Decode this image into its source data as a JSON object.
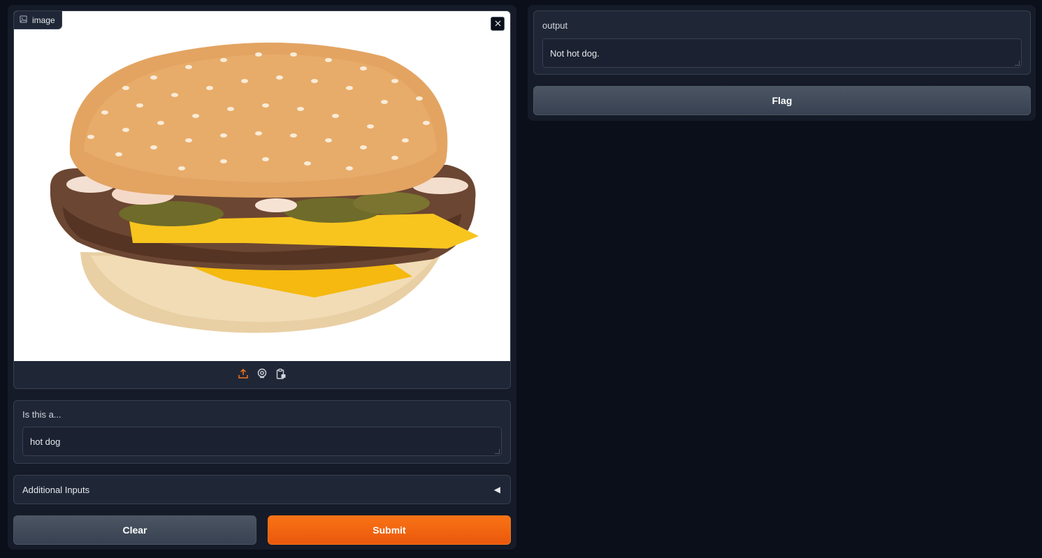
{
  "image_input": {
    "label": "image",
    "icon": "image-icon",
    "close_icon": "close-icon",
    "sources": [
      "upload-icon",
      "webcam-icon",
      "clipboard-icon"
    ]
  },
  "question": {
    "label": "Is this a...",
    "value": "hot dog"
  },
  "accordion": {
    "label": "Additional Inputs",
    "arrow": "◀"
  },
  "actions": {
    "clear_label": "Clear",
    "submit_label": "Submit",
    "flag_label": "Flag"
  },
  "output": {
    "label": "output",
    "value": "Not hot dog."
  },
  "colors": {
    "background": "#0b0f19",
    "panel": "#1f2737",
    "accent": "#f97316"
  }
}
